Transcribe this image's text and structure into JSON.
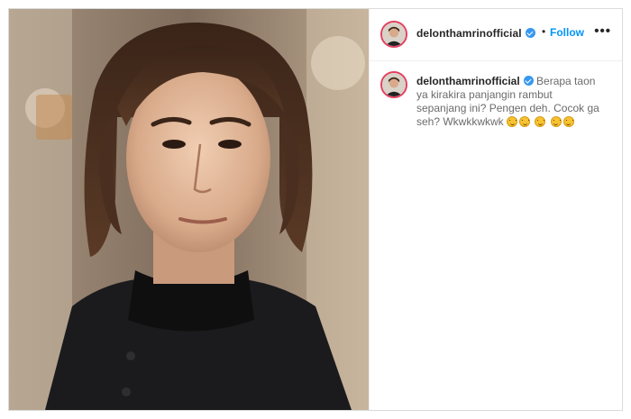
{
  "post": {
    "username": "delonthamrinofficial",
    "separator": "•",
    "follow_label": "Follow",
    "more_label": "•••",
    "verified": true
  },
  "caption": {
    "username": "delonthamrinofficial",
    "text": "Berapa taon ya kirakira panjangin rambut sepanjang ini? Pengen deh. Cocok ga seh? Wkwkkwkwk",
    "emojis": [
      "grinning-squint-emoji",
      "grinning-squint-emoji",
      "smiling-emoji",
      "thinking-emoji",
      "thinking-emoji"
    ]
  },
  "colors": {
    "accent": "#0095f6",
    "verified": "#3897f0",
    "avatar_ring": "#e3405f"
  }
}
